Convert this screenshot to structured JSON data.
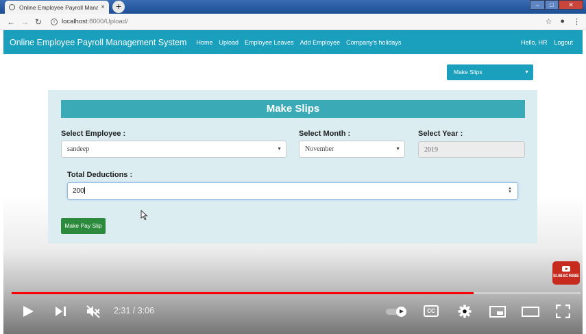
{
  "browser": {
    "tab_title": "Online Employee Payroll Manage",
    "tab_close": "×",
    "new_tab": "+",
    "url_host": "localhost",
    "url_rest": ":8000/Upload/",
    "icons": [
      "globe-icon",
      "back-icon",
      "forward-icon",
      "reload-icon",
      "info-icon",
      "star-icon",
      "account-icon",
      "menu-icon"
    ]
  },
  "navbar": {
    "brand": "Online Employee Payroll Management System",
    "links": [
      "Home",
      "Upload",
      "Employee Leaves",
      "Add Employee",
      "Company's holidays"
    ],
    "greeting": "Hello, HR",
    "logout": "Logout",
    "color": "#1a9fbd"
  },
  "top_select": {
    "value": "Make Slips"
  },
  "form": {
    "title": "Make Slips",
    "employee_label": "Select Employee :",
    "employee_value": "sandeep",
    "month_label": "Select Month :",
    "month_value": "November",
    "year_label": "Select Year :",
    "year_value": "2019",
    "deductions_label": "Total Deductions :",
    "deductions_value": "200",
    "submit_label": "Make Pay Slip",
    "submit_color": "#2c8a3c"
  },
  "subscribe": {
    "label": "SUBSCRIBE"
  },
  "player": {
    "time": "2:31 / 3:06",
    "progress_fraction": 0.8118,
    "icons": [
      "play-icon",
      "next-icon",
      "mute-icon",
      "autoplay-toggle",
      "cc-icon",
      "settings-icon",
      "miniplayer-icon",
      "theater-icon",
      "fullscreen-icon"
    ],
    "cc_label": "CC"
  }
}
